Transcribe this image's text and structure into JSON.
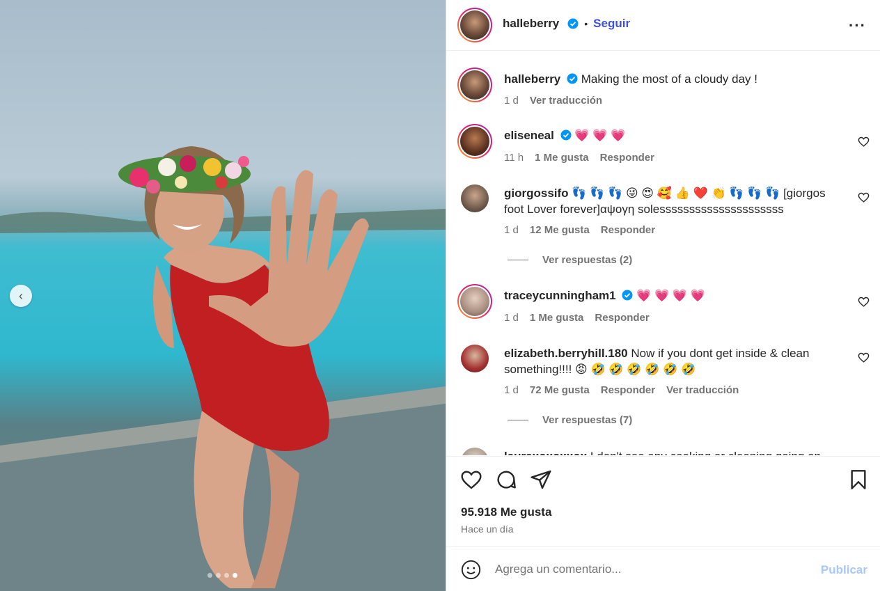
{
  "post": {
    "author": "halleberry",
    "follow_label": "Seguir",
    "more_icon": "more-options-icon",
    "separator": "•"
  },
  "caption": {
    "username": "halleberry",
    "text": "Making the most of a cloudy day !",
    "age": "1 d",
    "translate_label": "Ver traducción"
  },
  "comments": [
    {
      "username": "eliseneal",
      "text": "💗 💗 💗",
      "age": "11 h",
      "likes": "1 Me gusta",
      "reply": "Responder"
    },
    {
      "username": "giorgossifo",
      "text": "👣 👣 👣 😜 😍 🥰 👍 ❤️ 👏 👣 👣 👣 [giorgos foot Lover forever]αψογη solesssssssssssssssssssss",
      "age": "1 d",
      "likes": "12 Me gusta",
      "reply": "Responder",
      "view_replies": "Ver respuestas (2)"
    },
    {
      "username": "traceycunningham1",
      "text": "💗 💗 💗 💗",
      "age": "1 d",
      "likes": "1 Me gusta",
      "reply": "Responder"
    },
    {
      "username": "elizabeth.berryhill.180",
      "text": "Now if you dont get inside & clean something!!!! 😡 🤣 🤣 🤣 🤣 🤣 🤣",
      "age": "1 d",
      "likes": "72 Me gusta",
      "reply": "Responder",
      "translate": "Ver traducción",
      "view_replies": "Ver respuestas (7)"
    },
    {
      "username": "lauraxoxoxxox",
      "text": "I don't see any cooking or cleaning going on"
    }
  ],
  "footer": {
    "likes": "95.918 Me gusta",
    "time": "Hace un día",
    "comment_placeholder": "Agrega un comentario...",
    "publish_label": "Publicar"
  },
  "carousel": {
    "slides": 4,
    "active_index": 3
  },
  "colors": {
    "accent": "#0095f6",
    "follow": "#3f51d8",
    "publish_disabled": "#a8c7fa"
  }
}
